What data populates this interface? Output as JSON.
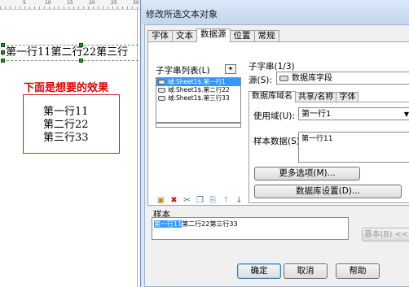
{
  "designer": {
    "ruler_labels": [
      "5",
      "10",
      "15",
      "20",
      "25",
      "30"
    ],
    "label_text": "第一行11第二行22第三行",
    "effect_title": "下面是想要的效果",
    "effect_lines": [
      "第一行11",
      "第二行22",
      "第三行33"
    ]
  },
  "dialog": {
    "title": "修改所选文本对象",
    "tabs": [
      "字体",
      "文本",
      "数据源",
      "位置",
      "常规"
    ],
    "active_tab": "数据源",
    "substring_list": {
      "label": "子字串列表(L)",
      "items": [
        "域:Sheet1$.第一行1",
        "域:Sheet1$.第二行22",
        "域:Sheet1$.第三行33"
      ],
      "selected_index": 0
    },
    "substring_header": "子字串(1/3)",
    "source_label": "源(S):",
    "source_value": "数据库字段",
    "subtabs": [
      "数据库域名",
      "共享/名称",
      "字体"
    ],
    "use_domain_label": "使用域(U):",
    "use_domain_value": "第一行1",
    "sample_data_label": "样本数据(S):",
    "sample_data_value": "第一行11",
    "more_options_button": "更多选项(M)...",
    "db_settings_button": "数据库设置(D)...",
    "sample_section_label": "样本",
    "sample_highlighted": "第一行11",
    "sample_rest": "第二行22第三行33",
    "basic_button": "基本(B) <<",
    "ok_button": "确定",
    "cancel_button": "取消",
    "help_button": "帮助"
  },
  "colors": {
    "accent_red": "#e00000",
    "selection_blue": "#3399ff",
    "dialog_frame": "#dce6f4"
  }
}
